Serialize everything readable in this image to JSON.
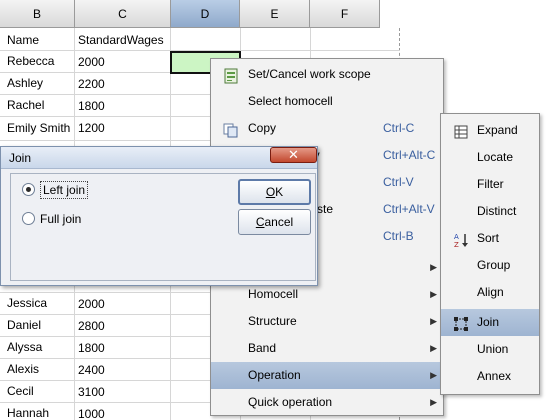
{
  "sheet": {
    "columns": [
      "B",
      "C",
      "D",
      "E",
      "F"
    ],
    "selected_column": "D",
    "rows": [
      {
        "b": "Name",
        "c": "StandardWages"
      },
      {
        "b": "Rebecca",
        "c": "2000"
      },
      {
        "b": "Ashley",
        "c": "2200"
      },
      {
        "b": "Rachel",
        "c": "1800"
      },
      {
        "b": "Emily Smith",
        "c": "1200"
      },
      {
        "b": "Jessica",
        "c": "2000"
      },
      {
        "b": "Daniel",
        "c": "2800"
      },
      {
        "b": "Alyssa",
        "c": "1800"
      },
      {
        "b": "Alexis",
        "c": "2400"
      },
      {
        "b": "Cecil",
        "c": "3100"
      },
      {
        "b": "Hannah",
        "c": "1000"
      }
    ]
  },
  "context_menu": {
    "items": [
      {
        "label": "Set/Cancel work scope",
        "shortcut": "",
        "icon": "work-scope-icon",
        "submenu": false
      },
      {
        "label": "Select homocell",
        "shortcut": "",
        "icon": "",
        "submenu": false
      },
      {
        "label": "Copy",
        "shortcut": "Ctrl-C",
        "icon": "copy-icon",
        "submenu": false
      },
      {
        "label": "py",
        "shortcut": "Ctrl+Alt-C",
        "icon": "",
        "submenu": false
      },
      {
        "label": "",
        "shortcut": "Ctrl-V",
        "icon": "",
        "submenu": false
      },
      {
        "label": "ste",
        "shortcut": "Ctrl+Alt-V",
        "icon": "",
        "submenu": false
      },
      {
        "label": "",
        "shortcut": "Ctrl-B",
        "icon": "",
        "submenu": false
      },
      {
        "label": "",
        "shortcut": "",
        "icon": "",
        "submenu": true
      },
      {
        "label": "Homocell",
        "shortcut": "",
        "icon": "",
        "submenu": true
      },
      {
        "label": "Structure",
        "shortcut": "",
        "icon": "",
        "submenu": true
      },
      {
        "label": "Band",
        "shortcut": "",
        "icon": "",
        "submenu": true
      },
      {
        "label": "Operation",
        "shortcut": "",
        "icon": "",
        "submenu": true,
        "highlighted": true
      },
      {
        "label": "Quick operation",
        "shortcut": "",
        "icon": "",
        "submenu": true
      }
    ]
  },
  "operation_submenu": {
    "items": [
      {
        "label": "Expand",
        "icon": "expand-icon"
      },
      {
        "label": "Locate",
        "icon": ""
      },
      {
        "label": "Filter",
        "icon": ""
      },
      {
        "label": "Distinct",
        "icon": ""
      },
      {
        "label": "Sort",
        "icon": "sort-az-icon"
      },
      {
        "label": "Group",
        "icon": ""
      },
      {
        "label": "Align",
        "icon": ""
      },
      {
        "label": "Join",
        "icon": "join-icon",
        "highlighted": true
      },
      {
        "label": "Union",
        "icon": ""
      },
      {
        "label": "Annex",
        "icon": ""
      }
    ]
  },
  "join_dialog": {
    "title": "Join",
    "close_symbol": "✕",
    "options": [
      {
        "label": "Left join",
        "checked": true
      },
      {
        "label": "Full join",
        "checked": false
      }
    ],
    "ok_label": "OK",
    "ok_mnemonic": "O",
    "ok_rest": "K",
    "cancel_mnemonic": "C",
    "cancel_rest": "ancel"
  }
}
